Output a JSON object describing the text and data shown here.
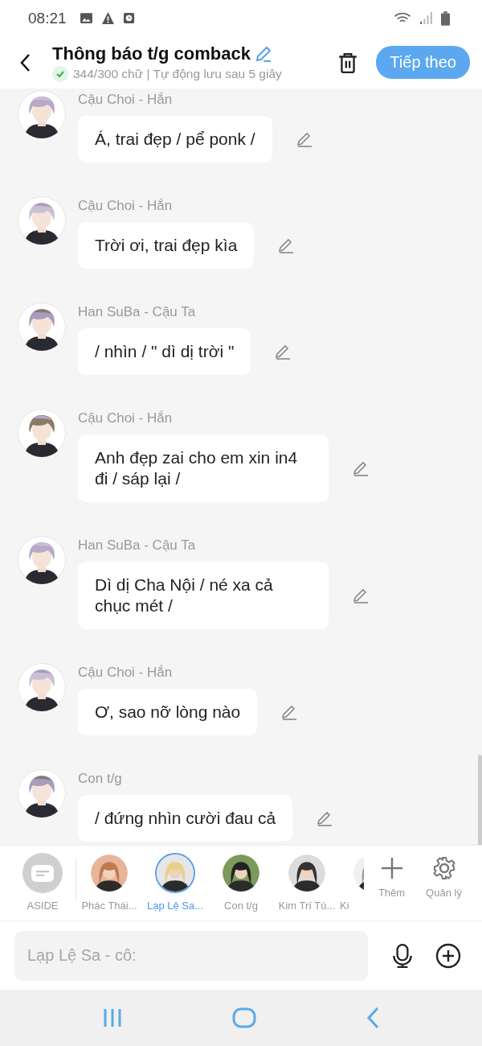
{
  "status_bar": {
    "time": "08:21"
  },
  "header": {
    "title": "Thông báo t/g comback",
    "subtitle": "344/300 chữ | Tự động lưu sau 5 giây",
    "saved": true,
    "next_button": "Tiếp theo"
  },
  "messages": [
    {
      "sender": "Cậu Choi - Hắn",
      "text": "Á, trai đẹp / pể ponk /"
    },
    {
      "sender": "Cậu Choi - Hắn",
      "text": "Trời ơi, trai đẹp kìa"
    },
    {
      "sender": "Han SuBa - Cậu Ta",
      "text": "/ nhìn / \" dì dị trời \""
    },
    {
      "sender": "Cậu Choi - Hắn",
      "text": "Anh đẹp zai cho em xin in4 đi / sáp lại /"
    },
    {
      "sender": "Han SuBa - Cậu Ta",
      "text": "Dì dị Cha Nội / né xa cả chục mét /"
    },
    {
      "sender": "Cậu Choi - Hắn",
      "text": "Ơ, sao nỡ lòng nào"
    },
    {
      "sender": "Con t/g",
      "text": "/ đứng nhìn cười đau cả"
    }
  ],
  "characters": [
    {
      "label": "ASIDE",
      "kind": "aside",
      "selected": false
    },
    {
      "label": "Phác Thái...",
      "kind": "person",
      "selected": false
    },
    {
      "label": "Lạp Lệ Sa...",
      "kind": "person",
      "selected": true
    },
    {
      "label": "Con t/g",
      "kind": "person",
      "selected": false
    },
    {
      "label": "Kim Trí Tú...",
      "kind": "person",
      "selected": false
    },
    {
      "label": "Ki",
      "kind": "person",
      "selected": false
    }
  ],
  "actions": [
    "Thêm",
    "Quản lý"
  ],
  "composer": {
    "placeholder": "Lạp Lệ Sa - cô:"
  }
}
